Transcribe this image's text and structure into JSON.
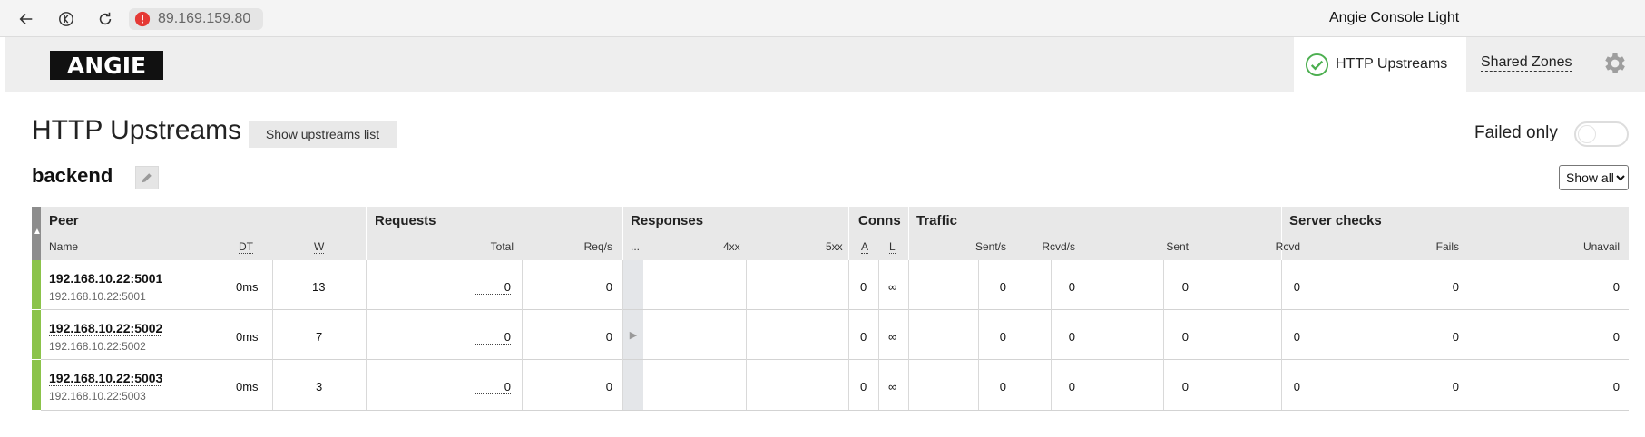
{
  "browser": {
    "url": "89.169.159.80",
    "title": "Angie Console Light"
  },
  "header": {
    "logo": "ANGIE",
    "tabs": [
      {
        "label": "HTTP Upstreams",
        "active": true
      },
      {
        "label": "Shared Zones",
        "active": false
      }
    ]
  },
  "page": {
    "title": "HTTP Upstreams",
    "show_list_label": "Show upstreams list",
    "failed_only_label": "Failed only",
    "failed_only_on": false
  },
  "upstream": {
    "name": "backend",
    "filter_value": "Show all",
    "groups": {
      "peer": "Peer",
      "requests": "Requests",
      "responses": "Responses",
      "conns": "Conns",
      "traffic": "Traffic",
      "server_checks": "Server checks"
    },
    "columns": {
      "name": "Name",
      "dt": "DT",
      "w": "W",
      "total": "Total",
      "req_s": "Req/s",
      "ellipsis": "...",
      "r4xx": "4xx",
      "r5xx": "5xx",
      "a": "A",
      "l": "L",
      "sent_s": "Sent/s",
      "rcvd_s": "Rcvd/s",
      "sent": "Sent",
      "rcvd": "Rcvd",
      "fails": "Fails",
      "unavail": "Unavail"
    },
    "rows": [
      {
        "name": "192.168.10.22:5001",
        "addr": "192.168.10.22:5001",
        "dt": "0ms",
        "w": "13",
        "total": "0",
        "req_s": "0",
        "a": "0",
        "l": "∞",
        "sent_s": "0",
        "rcvd_s": "0",
        "sent": "0",
        "rcvd": "0",
        "fails": "0",
        "unavail": "0"
      },
      {
        "name": "192.168.10.22:5002",
        "addr": "192.168.10.22:5002",
        "dt": "0ms",
        "w": "7",
        "total": "0",
        "req_s": "0",
        "a": "0",
        "l": "∞",
        "sent_s": "0",
        "rcvd_s": "0",
        "sent": "0",
        "rcvd": "0",
        "fails": "0",
        "unavail": "0"
      },
      {
        "name": "192.168.10.22:5003",
        "addr": "192.168.10.22:5003",
        "dt": "0ms",
        "w": "3",
        "total": "0",
        "req_s": "0",
        "a": "0",
        "l": "∞",
        "sent_s": "0",
        "rcvd_s": "0",
        "sent": "0",
        "rcvd": "0",
        "fails": "0",
        "unavail": "0"
      }
    ],
    "expand_glyph": "▶",
    "sort_glyph": "▲"
  },
  "colors": {
    "peer_up": "#8bc34a",
    "header_bg": "#e8e8e8",
    "ok_icon": "#4caf50",
    "warn_icon": "#e53935"
  },
  "icons": [
    "back-arrow-icon",
    "yandex-icon",
    "reload-icon",
    "warning-icon",
    "check-circle-icon",
    "gear-icon",
    "pencil-icon"
  ]
}
